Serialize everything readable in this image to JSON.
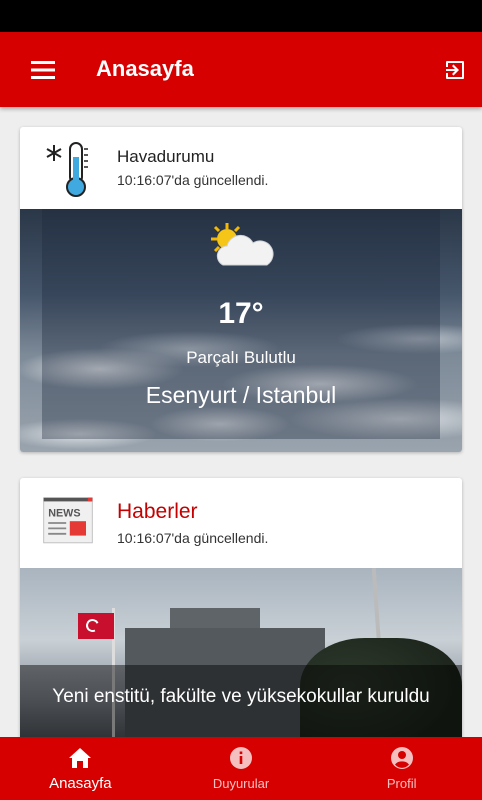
{
  "app_bar": {
    "title": "Anasayfa",
    "menu_icon": "menu-icon",
    "logout_icon": "exit-icon"
  },
  "weather_card": {
    "title": "Havadurumu",
    "updated": "10:16:07'da güncellendi.",
    "temperature": "17°",
    "condition": "Parçalı Bulutlu",
    "location": "Esenyurt / Istanbul",
    "icon": "thermometer-icon",
    "condition_icon": "partly-cloudy-icon"
  },
  "news_card": {
    "title": "Haberler",
    "updated": "10:16:07'da güncellendi.",
    "headline": "Yeni enstitü, fakülte ve yüksekokullar kuruldu",
    "icon": "newspaper-icon",
    "icon_label": "NEWS"
  },
  "bottom_nav": {
    "items": [
      {
        "label": "Anasayfa",
        "icon": "home-icon",
        "active": true
      },
      {
        "label": "Duyurular",
        "icon": "info-icon",
        "active": false
      },
      {
        "label": "Profil",
        "icon": "account-icon",
        "active": false
      }
    ]
  },
  "colors": {
    "primary": "#d60000",
    "accent_text": "#c40000"
  }
}
